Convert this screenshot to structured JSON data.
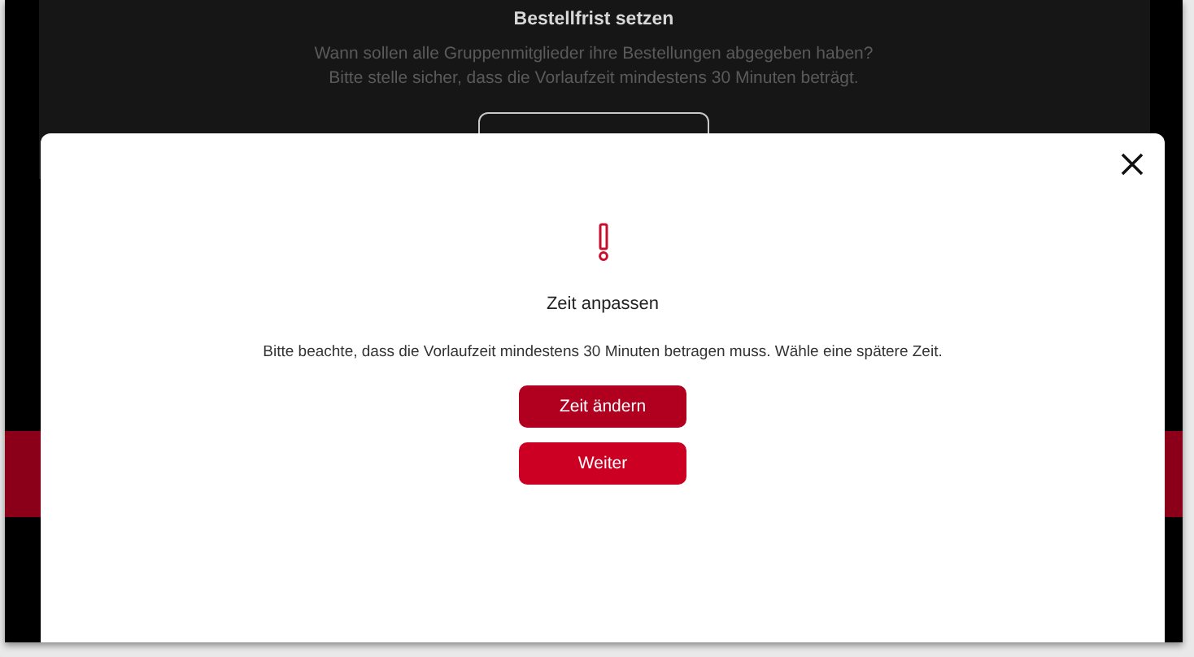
{
  "background_panel": {
    "title": "Bestellfrist setzen",
    "description_lines": [
      "Wann sollen alle Gruppenmitglieder ihre Bestellungen abgegeben haben?",
      "Bitte stelle sicher, dass die Vorlaufzeit mindestens 30 Minuten beträgt."
    ]
  },
  "dialog": {
    "title": "Zeit anpassen",
    "message": "Bitte beachte, dass die Vorlaufzeit mindestens 30 Minuten betragen muss. Wähle eine spätere Zeit.",
    "buttons": [
      {
        "label": "Zeit ändern",
        "kind": "primary"
      },
      {
        "label": "Weiter",
        "kind": "secondary"
      }
    ]
  }
}
